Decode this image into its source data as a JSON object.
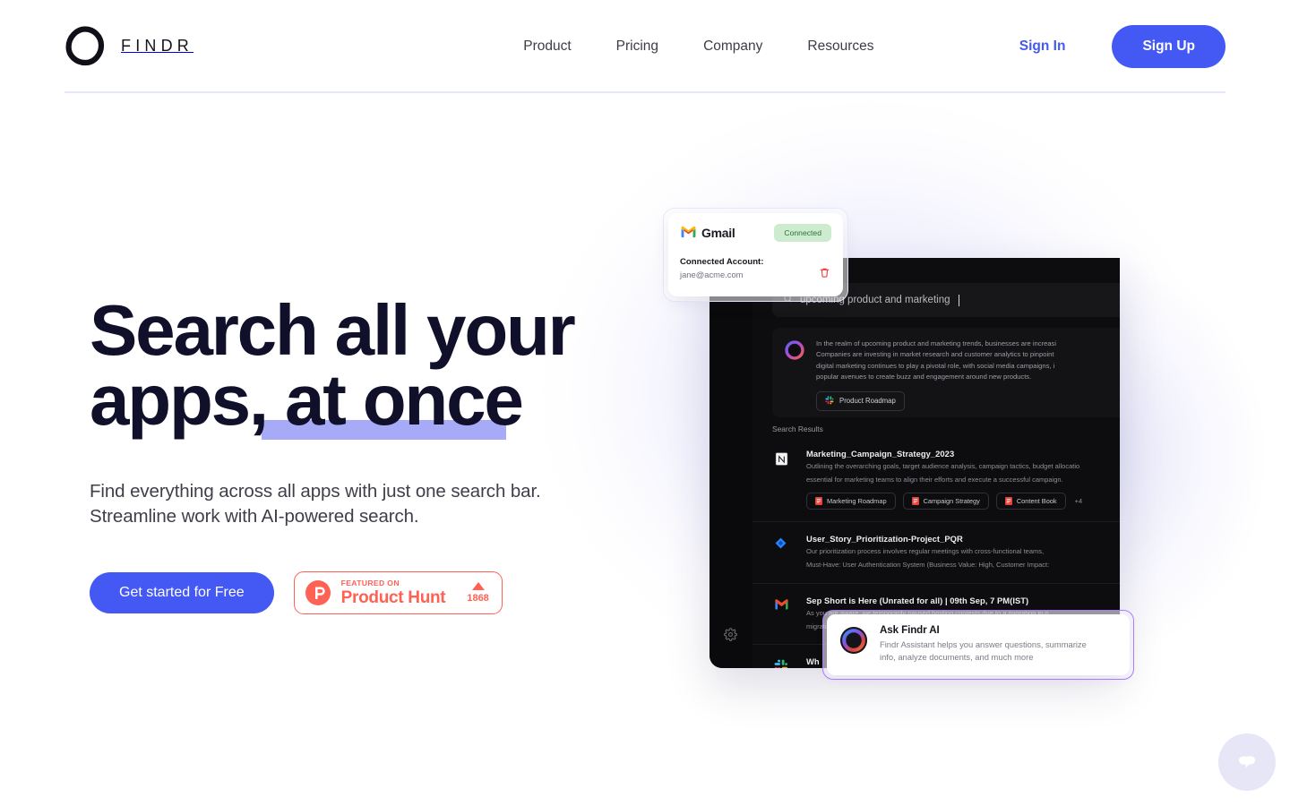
{
  "header": {
    "logo_text": "FINDR",
    "logo_icon": "findr-blob-logo",
    "nav": [
      {
        "label": "Product"
      },
      {
        "label": "Pricing"
      },
      {
        "label": "Company"
      },
      {
        "label": "Resources"
      }
    ],
    "sign_in_label": "Sign In",
    "sign_up_label": "Sign Up"
  },
  "hero": {
    "headline_line1": "Search all your",
    "headline_line2_plain": "apps,",
    "headline_line2_highlight": "at once",
    "highlight_color": "#a7aaf6",
    "subheading": "Find everything across all apps with just one search bar. Streamline work with AI-powered search.",
    "cta_primary_label": "Get started for Free",
    "product_hunt": {
      "featured_label": "FEATURED ON",
      "name": "Product Hunt",
      "upvotes": "1868",
      "accent_color": "#ff6154"
    },
    "accent_color": "#4458f4"
  },
  "illustration": {
    "gmail_card": {
      "app_name": "Gmail",
      "app_icon": "gmail-icon",
      "status_badge": "Connected",
      "account_label": "Connected Account:",
      "account_email": "jane@acme.com",
      "delete_icon": "trash-icon"
    },
    "app": {
      "search_query": "upcoming product and marketing",
      "search_icon": "search-icon",
      "settings_icon": "gear-icon",
      "ai_answer": {
        "icon": "findr-orb-icon",
        "lines": [
          "In the realm of upcoming product and marketing trends, businesses are increasi",
          "Companies are investing in market research and customer analytics to pinpoint",
          "digital marketing continues to play a pivotal role, with social media campaigns, i",
          "popular avenues to create buzz and engagement around new products."
        ],
        "tag_label": "Product Roadmap",
        "tag_icon": "slack-icon"
      },
      "results_label": "Search Results",
      "results": [
        {
          "icon": "notion-icon",
          "title": "Marketing_Campaign_Strategy_2023",
          "desc_line1": "Outlining the overarching goals, target audience analysis, campaign tactics, budget allocatio",
          "desc_line2": "essential for marketing teams to align their efforts and execute a successful campaign.",
          "tags": [
            "Marketing Roadmap",
            "Campaign Strategy",
            "Content Book"
          ],
          "more_count": "+4"
        },
        {
          "icon": "jira-icon",
          "title": "User_Story_Prioritization-Project_PQR",
          "desc_line1": "Our prioritization process involves regular meetings with cross-functional teams,",
          "desc_line2": "Must-Have: User Authentication System (Business Value: High, Customer Impact:",
          "tags": [],
          "more_count": ""
        },
        {
          "icon": "gmail-icon",
          "title": "Sep Short is Here (Unrated for all) | 09th Sep, 7 PM(IST)",
          "desc_line1": "As you are aware, we temporarily paused hosting contests due to a migration in o",
          "desc_line2": "migration has been successfully completed, and as part of our testing phase, we",
          "tags": [],
          "more_count": ""
        },
        {
          "icon": "slack-icon",
          "title": "Wh",
          "desc_line1": "Wh",
          "desc_line2": "",
          "tags": [],
          "more_count": ""
        }
      ]
    },
    "ask_findr": {
      "icon": "findr-orb-icon",
      "title": "Ask Findr AI",
      "description": "Findr Assistant helps you answer questions, summarize info, analyze documents, and much more",
      "border_color": "#ab7dfb"
    }
  },
  "chat_widget": {
    "icon": "chat-bubble-icon",
    "background_color": "#e7e6f7"
  }
}
